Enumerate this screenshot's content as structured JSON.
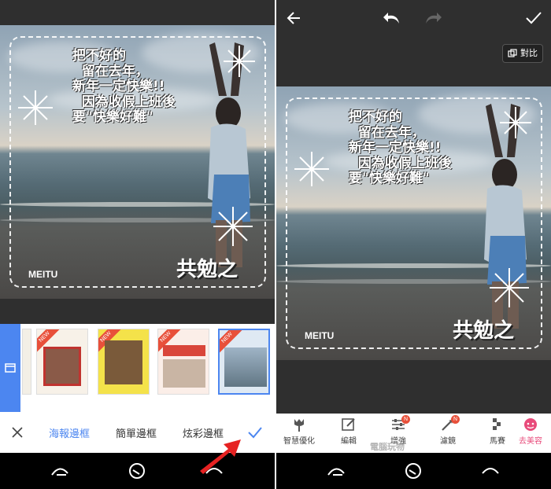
{
  "photo_text": {
    "lines": "把不好的\n  留在去年，\n新年一定快樂!!\n  因為收假上班後\n要\"快樂好難\"",
    "slogan": "共勉之",
    "brand": "MEITU"
  },
  "left": {
    "templates": [
      {
        "label": "",
        "new": "NEW"
      },
      {
        "label": "",
        "new": "NEW"
      },
      {
        "label": "",
        "new": "NEW"
      },
      {
        "label": "",
        "new": "NEW"
      }
    ],
    "tabs": [
      "海報邊框",
      "簡單邊框",
      "炫彩邊框"
    ],
    "active_tab": "海報邊框"
  },
  "right": {
    "compare_label": "對比",
    "tools": [
      {
        "label": "智慧優化",
        "icon": "tulip-icon"
      },
      {
        "label": "編輯",
        "icon": "edit-icon"
      },
      {
        "label": "增強",
        "icon": "sliders-icon",
        "badge": "N"
      },
      {
        "label": "濾鏡",
        "icon": "magic-wand-icon",
        "badge": "N"
      },
      {
        "label": "馬賽",
        "icon": "mosaic-icon"
      },
      {
        "label": "去美容",
        "icon": "face-icon"
      }
    ],
    "watermark": "電腦玩物"
  },
  "colors": {
    "accent": "#4c86f0",
    "new_badge": "#e8503a",
    "highlight": "#e84a7a",
    "arrow": "#e62222"
  }
}
